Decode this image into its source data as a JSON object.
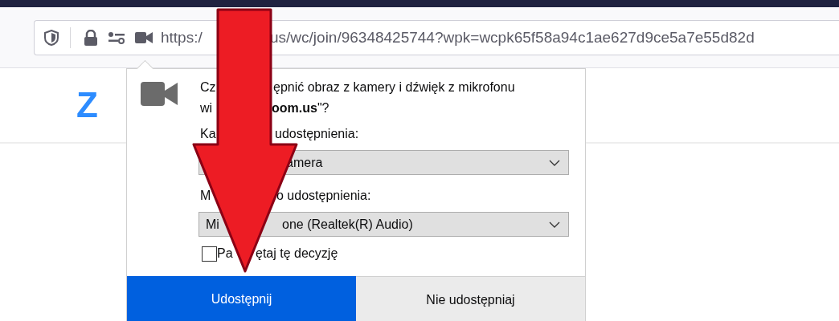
{
  "browser": {
    "url_parts": [
      "https:/",
      "us/wc/join/96348425744?wpk=wcpk65f58a94c1ae627d9ce5a7e55d82d"
    ]
  },
  "page": {
    "logo": "Z"
  },
  "popup": {
    "question": [
      [
        "Cz",
        "ępnić obraz z kamery i dźwięk z mikrofonu"
      ],
      [
        "wi",
        "**oom.us**\"?"
      ]
    ],
    "camera_label": [
      "Ka",
      "udostępnienia:"
    ],
    "camera_select": "amera",
    "mic_label": [
      "M",
      "o udostępnienia:"
    ],
    "mic_select": [
      "Mi",
      "one (Realtek(R) Audio)"
    ],
    "remember": {
      "parts": [
        "Pa",
        "ętaj tę decyzję"
      ],
      "checked": false
    },
    "buttons": [
      {
        "label": "Udostępnij",
        "kind": "primary"
      },
      {
        "label": "Nie udostępniaj",
        "kind": "secondary"
      }
    ]
  }
}
